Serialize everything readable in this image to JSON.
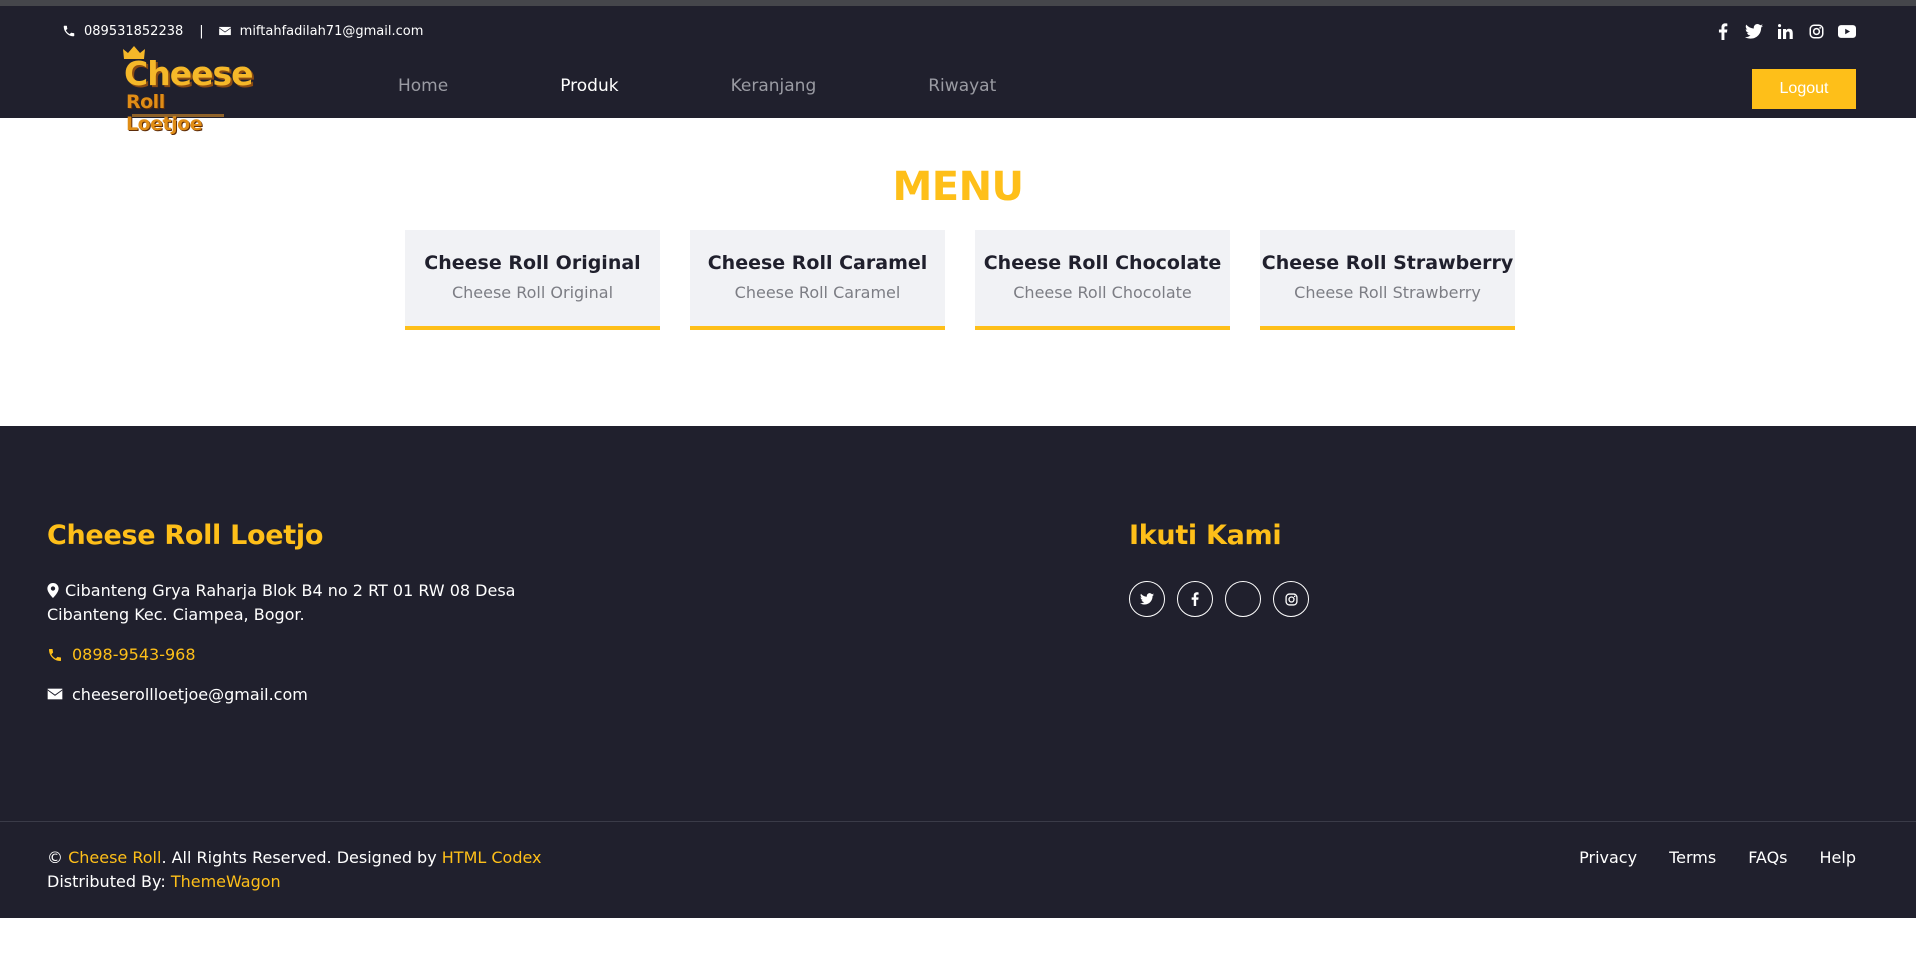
{
  "topbar": {
    "phone": "089531852238",
    "separator": "|",
    "email": "miftahfadilah71@gmail.com",
    "social_icons": [
      "facebook-icon",
      "twitter-icon",
      "linkedin-icon",
      "instagram-icon",
      "youtube-icon"
    ]
  },
  "brand": {
    "logo_line1": "Cheese",
    "logo_line2": "Roll Loetjoe"
  },
  "nav": {
    "items": [
      {
        "label": "Home",
        "active": false
      },
      {
        "label": "Produk",
        "active": true
      },
      {
        "label": "Keranjang",
        "active": false
      },
      {
        "label": "Riwayat",
        "active": false
      }
    ],
    "logout_label": "Logout"
  },
  "main": {
    "title": "MENU",
    "cards": [
      {
        "title": "Cheese Roll Original",
        "subtitle": "Cheese Roll Original"
      },
      {
        "title": "Cheese Roll Caramel",
        "subtitle": "Cheese Roll Caramel"
      },
      {
        "title": "Cheese Roll Chocolate",
        "subtitle": "Cheese Roll Chocolate"
      },
      {
        "title": "Cheese Roll Strawberry",
        "subtitle": "Cheese Roll Strawberry"
      }
    ]
  },
  "footer": {
    "brand_title": "Cheese Roll Loetjo",
    "address": "Cibanteng Grya Raharja Blok B4 no 2 RT 01 RW 08 Desa Cibanteng Kec. Ciampea, Bogor.",
    "phone": "0898-9543-968",
    "email": "cheeserollloetjoe@gmail.com",
    "follow_title": "Ikuti Kami",
    "social_icons": [
      "twitter-icon",
      "facebook-icon",
      "blank-icon",
      "instagram-icon"
    ],
    "copyright": {
      "prefix": "© ",
      "brand": "Cheese Roll",
      "middle": ". All Rights Reserved. Designed by ",
      "designer": "HTML Codex",
      "distributed_prefix": "Distributed By: ",
      "distributor": "ThemeWagon"
    },
    "links": [
      "Privacy",
      "Terms",
      "FAQs",
      "Help"
    ]
  },
  "colors": {
    "accent": "#febf19",
    "dark": "#20202d",
    "card_bg": "#f1f2f5"
  }
}
